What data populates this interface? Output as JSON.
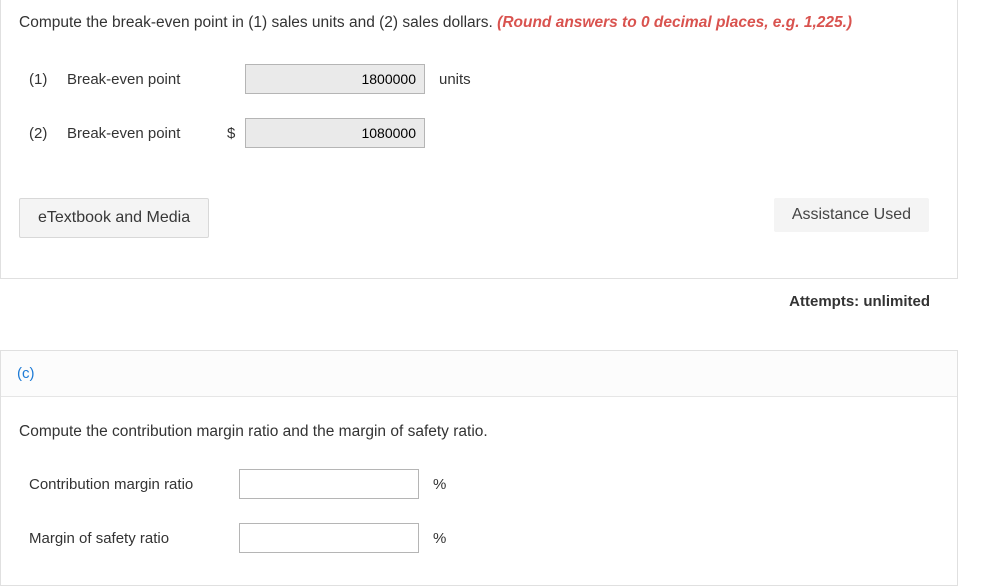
{
  "question_top": {
    "text_prefix": "Compute the break-even point in (1) sales units and (2) sales dollars. ",
    "text_hint": "(Round answers to 0 decimal places, e.g. 1,225.)"
  },
  "row1": {
    "num": "(1)",
    "label": "Break-even point",
    "value": "1800000",
    "unit": "units"
  },
  "row2": {
    "num": "(2)",
    "label": "Break-even point",
    "currency": "$",
    "value": "1080000"
  },
  "etextbook_label": "eTextbook and Media",
  "assistance_label": "Assistance Used",
  "attempts_label": "Attempts: unlimited",
  "part_c": {
    "heading": "(c)",
    "question": "Compute the contribution margin ratio and the margin of safety ratio.",
    "row1": {
      "label": "Contribution margin ratio",
      "value": "",
      "unit": "%"
    },
    "row2": {
      "label": "Margin of safety ratio",
      "value": "",
      "unit": "%"
    }
  }
}
